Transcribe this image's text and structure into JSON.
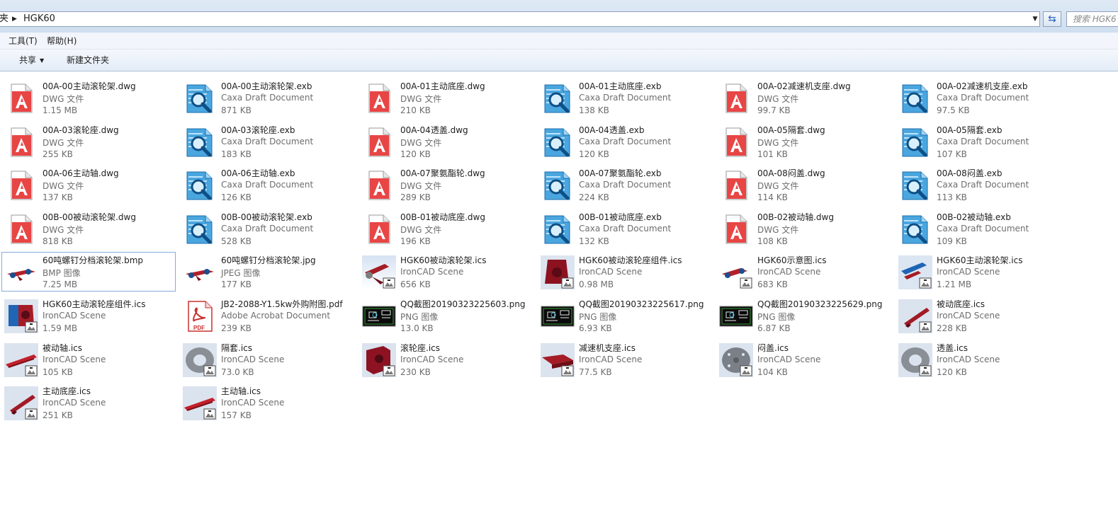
{
  "address": {
    "prev": "夹",
    "current": "HGK60",
    "search_placeholder": "搜索 HGK6"
  },
  "menu": [
    "工具(T)",
    "帮助(H)"
  ],
  "toolbar": {
    "share_label": "共享",
    "new_folder_label": "新建文件夹"
  },
  "files": [
    {
      "name": "00A-00主动滚轮架.dwg",
      "type": "DWG 文件",
      "size": "1.15 MB",
      "icon": "dwg"
    },
    {
      "name": "00A-00主动滚轮架.exb",
      "type": "Caxa Draft Document",
      "size": "871 KB",
      "icon": "exb"
    },
    {
      "name": "00A-01主动底座.dwg",
      "type": "DWG 文件",
      "size": "210 KB",
      "icon": "dwg"
    },
    {
      "name": "00A-01主动底座.exb",
      "type": "Caxa Draft Document",
      "size": "138 KB",
      "icon": "exb"
    },
    {
      "name": "00A-02减速机支座.dwg",
      "type": "DWG 文件",
      "size": "99.7 KB",
      "icon": "dwg"
    },
    {
      "name": "00A-02减速机支座.exb",
      "type": "Caxa Draft Document",
      "size": "97.5 KB",
      "icon": "exb"
    },
    {
      "name": "00A-03滚轮座.dwg",
      "type": "DWG 文件",
      "size": "255 KB",
      "icon": "dwg"
    },
    {
      "name": "00A-03滚轮座.exb",
      "type": "Caxa Draft Document",
      "size": "183 KB",
      "icon": "exb"
    },
    {
      "name": "00A-04透盖.dwg",
      "type": "DWG 文件",
      "size": "120 KB",
      "icon": "dwg"
    },
    {
      "name": "00A-04透盖.exb",
      "type": "Caxa Draft Document",
      "size": "120 KB",
      "icon": "exb"
    },
    {
      "name": "00A-05隔套.dwg",
      "type": "DWG 文件",
      "size": "101 KB",
      "icon": "dwg"
    },
    {
      "name": "00A-05隔套.exb",
      "type": "Caxa Draft Document",
      "size": "107 KB",
      "icon": "exb"
    },
    {
      "name": "00A-06主动轴.dwg",
      "type": "DWG 文件",
      "size": "137 KB",
      "icon": "dwg"
    },
    {
      "name": "00A-06主动轴.exb",
      "type": "Caxa Draft Document",
      "size": "126 KB",
      "icon": "exb"
    },
    {
      "name": "00A-07聚氨酯轮.dwg",
      "type": "DWG 文件",
      "size": "289 KB",
      "icon": "dwg"
    },
    {
      "name": "00A-07聚氨酯轮.exb",
      "type": "Caxa Draft Document",
      "size": "224 KB",
      "icon": "exb"
    },
    {
      "name": "00A-08闷盖.dwg",
      "type": "DWG 文件",
      "size": "114 KB",
      "icon": "dwg"
    },
    {
      "name": "00A-08闷盖.exb",
      "type": "Caxa Draft Document",
      "size": "113 KB",
      "icon": "exb"
    },
    {
      "name": "00B-00被动滚轮架.dwg",
      "type": "DWG 文件",
      "size": "818 KB",
      "icon": "dwg"
    },
    {
      "name": "00B-00被动滚轮架.exb",
      "type": "Caxa Draft Document",
      "size": "528 KB",
      "icon": "exb"
    },
    {
      "name": "00B-01被动底座.dwg",
      "type": "DWG 文件",
      "size": "196 KB",
      "icon": "dwg"
    },
    {
      "name": "00B-01被动底座.exb",
      "type": "Caxa Draft Document",
      "size": "132 KB",
      "icon": "exb"
    },
    {
      "name": "00B-02被动轴.dwg",
      "type": "DWG 文件",
      "size": "108 KB",
      "icon": "dwg"
    },
    {
      "name": "00B-02被动轴.exb",
      "type": "Caxa Draft Document",
      "size": "109 KB",
      "icon": "exb"
    },
    {
      "name": "60吨螺钉分档滚轮架.bmp",
      "type": "BMP 图像",
      "size": "7.25 MB",
      "icon": "thumb-assembly",
      "selected": true
    },
    {
      "name": "60吨螺钉分档滚轮架.jpg",
      "type": "JPEG 图像",
      "size": "177 KB",
      "icon": "thumb-assembly"
    },
    {
      "name": "HGK60被动滚轮架.ics",
      "type": "IronCAD Scene",
      "size": "656 KB",
      "icon": "ics-frame"
    },
    {
      "name": "HGK60被动滚轮座组件.ics",
      "type": "IronCAD Scene",
      "size": "0.98 MB",
      "icon": "ics-block"
    },
    {
      "name": "HGK60示意图.ics",
      "type": "IronCAD Scene",
      "size": "683 KB",
      "icon": "ics-assembly"
    },
    {
      "name": "HGK60主动滚轮架.ics",
      "type": "IronCAD Scene",
      "size": "1.21 MB",
      "icon": "ics-frame-blue"
    },
    {
      "name": "HGK60主动滚轮座组件.ics",
      "type": "IronCAD Scene",
      "size": "1.59 MB",
      "icon": "ics-block-blue"
    },
    {
      "name": "JB2-2088-Y1.5kw外购附图.pdf",
      "type": "Adobe Acrobat Document",
      "size": "239 KB",
      "icon": "pdf"
    },
    {
      "name": "QQ截图20190323225603.png",
      "type": "PNG 图像",
      "size": "13.0 KB",
      "icon": "png-drawing"
    },
    {
      "name": "QQ截图20190323225617.png",
      "type": "PNG 图像",
      "size": "6.93 KB",
      "icon": "png-drawing"
    },
    {
      "name": "QQ截图20190323225629.png",
      "type": "PNG 图像",
      "size": "6.87 KB",
      "icon": "png-drawing"
    },
    {
      "name": "被动底座.ics",
      "type": "IronCAD Scene",
      "size": "228 KB",
      "icon": "ics-base"
    },
    {
      "name": "被动轴.ics",
      "type": "IronCAD Scene",
      "size": "105 KB",
      "icon": "ics-shaft"
    },
    {
      "name": "隔套.ics",
      "type": "IronCAD Scene",
      "size": "73.0 KB",
      "icon": "ics-ring"
    },
    {
      "name": "滚轮座.ics",
      "type": "IronCAD Scene",
      "size": "230 KB",
      "icon": "ics-seat"
    },
    {
      "name": "减速机支座.ics",
      "type": "IronCAD Scene",
      "size": "77.5 KB",
      "icon": "ics-plate"
    },
    {
      "name": "闷盖.ics",
      "type": "IronCAD Scene",
      "size": "104 KB",
      "icon": "ics-disc"
    },
    {
      "name": "透盖.ics",
      "type": "IronCAD Scene",
      "size": "120 KB",
      "icon": "ics-ring"
    },
    {
      "name": "主动底座.ics",
      "type": "IronCAD Scene",
      "size": "251 KB",
      "icon": "ics-base"
    },
    {
      "name": "主动轴.ics",
      "type": "IronCAD Scene",
      "size": "157 KB",
      "icon": "ics-shaft"
    }
  ]
}
